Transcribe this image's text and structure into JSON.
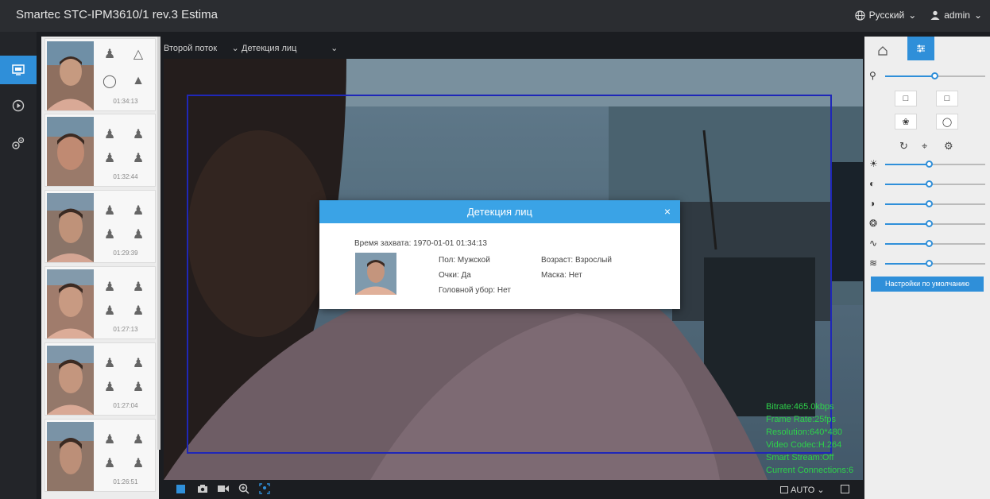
{
  "app": {
    "title": "Smartec STC-IPM3610/1 rev.3 Estima",
    "language": "Русский",
    "user": "admin"
  },
  "leftnav": [
    {
      "name": "live-view",
      "icon": "monitor-icon"
    },
    {
      "name": "playback",
      "icon": "play-circle-icon"
    },
    {
      "name": "settings",
      "icon": "gears-icon"
    }
  ],
  "toolbar": {
    "stream": "Второй поток",
    "mode": "Детекция лиц"
  },
  "thumbs": [
    {
      "time": "01:34:13"
    },
    {
      "time": "01:32:44"
    },
    {
      "time": "01:29:39"
    },
    {
      "time": "01:27:13"
    },
    {
      "time": "01:27:04"
    },
    {
      "time": "01:26:51"
    }
  ],
  "dialog": {
    "title": "Детекция лиц",
    "close": "×",
    "capture_time": "Время захвата: 1970-01-01 01:34:13",
    "gender": "Пол: Мужской",
    "age": "Возраст: Взрослый",
    "glasses": "Очки: Да",
    "mask": "Маска: Нет",
    "headwear": "Головной убор: Нет"
  },
  "stats": {
    "bitrate": "Bitrate:465.0kbps",
    "framerate": "Frame Rate:25fps",
    "resolution": "Resolution:640*480",
    "codec": "Video Codec:H.264",
    "smart": "Smart Stream:Off",
    "connections": "Current Connections:6"
  },
  "bottombar": {
    "auto": "AUTO"
  },
  "rightpanel": {
    "default_button": "Настройки по умолчанию",
    "sliders": [
      {
        "icon": "zoom-icon",
        "value": 0.55
      },
      {
        "icon": "brightness-icon",
        "value": 0.5
      },
      {
        "icon": "contrast-icon",
        "value": 0.5
      },
      {
        "icon": "saturation-icon",
        "value": 0.5
      },
      {
        "icon": "hue-icon",
        "value": 0.5
      },
      {
        "icon": "sharpness-icon",
        "value": 0.5
      },
      {
        "icon": "noise-icon",
        "value": 0.5
      }
    ]
  },
  "colors": {
    "accent": "#2f8fd9",
    "dialog_header": "#3aa3e6",
    "stats_green": "#2ed14a"
  }
}
